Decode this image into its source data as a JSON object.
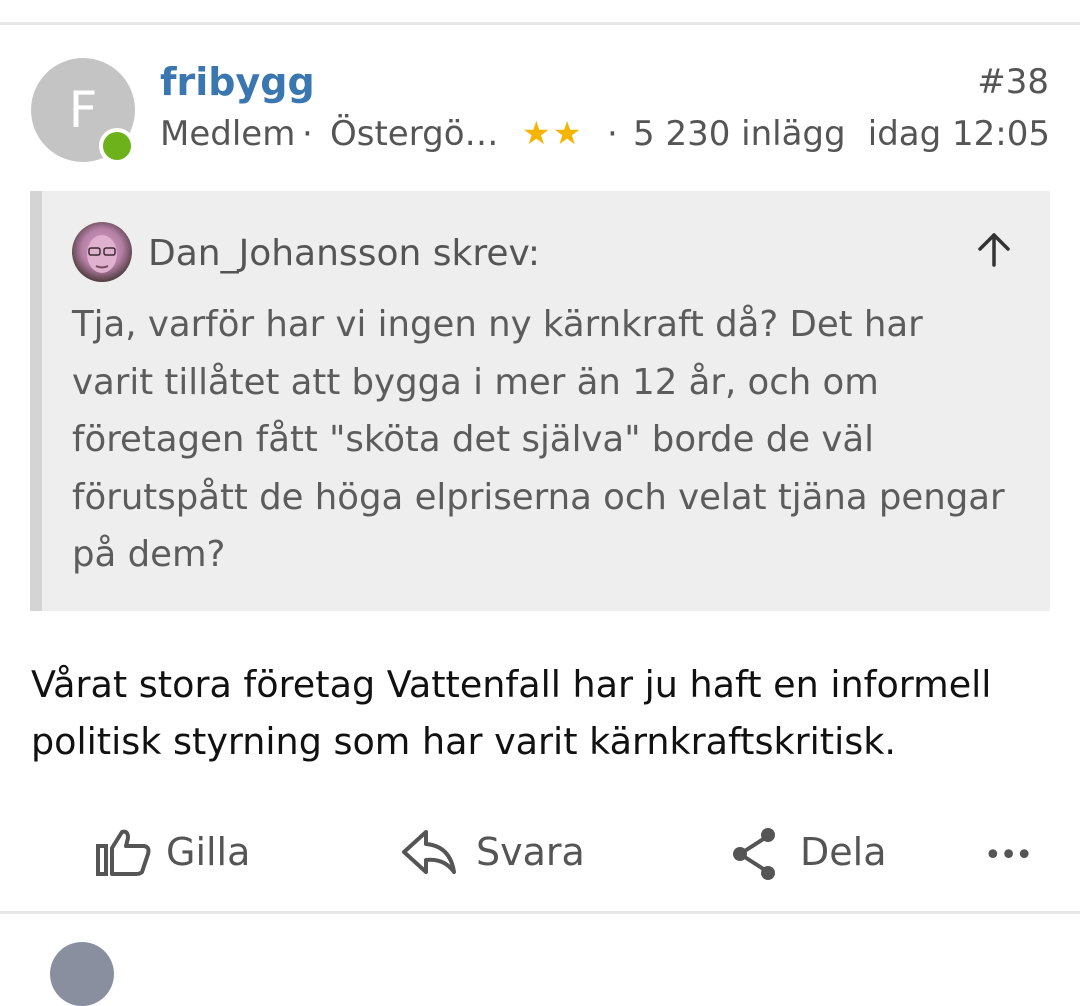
{
  "post": {
    "avatar_letter": "F",
    "username": "fribygg",
    "post_number": "#38",
    "role": "Medlem",
    "separator": "·",
    "location": "Östergö…",
    "stars": "★★",
    "post_count": "5 230 inlägg",
    "timestamp": "idag 12:05",
    "online_status_color": "#6db21a"
  },
  "quote": {
    "author_line": "Dan_Johansson skrev:",
    "text": "Tja, varför har vi ingen ny kärnkraft då? Det har varit tillåtet att bygga i mer än 12 år, och om företagen fått \"sköta det själva\" borde de väl förutspått de höga elpriserna och velat tjäna pengar på dem?",
    "icon": "arrow-up-icon"
  },
  "body": {
    "text": "Vårat stora företag Vattenfall har ju haft en informell politisk styrning som har varit kärnkraftskritisk."
  },
  "actions": {
    "like_label": "Gilla",
    "reply_label": "Svara",
    "share_label": "Dela",
    "more_label": "•••"
  },
  "colors": {
    "username": "#3a76b0",
    "stars": "#f4b400",
    "quote_background": "#eeeeee"
  }
}
